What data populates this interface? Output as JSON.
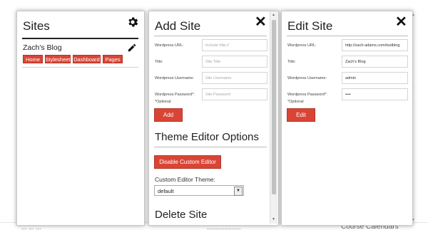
{
  "background": {
    "left_text": "... ... ...",
    "mid_text": "...................",
    "right_text": "Course Calendars"
  },
  "sites_panel": {
    "title": "Sites",
    "site_name": "Zach's Blog",
    "buttons": [
      "Home",
      "Stylesheet",
      "Dashboard",
      "Pages"
    ]
  },
  "add_site_panel": {
    "title": "Add Site",
    "fields": [
      {
        "label": "Wordpress URL:",
        "placeholder": "Include http://",
        "value": ""
      },
      {
        "label": "Title:",
        "placeholder": "Site Title",
        "value": ""
      },
      {
        "label": "Wordpress Username:",
        "placeholder": "Site Username",
        "value": ""
      },
      {
        "label": "Wordpress Password*:",
        "placeholder": "Site Password",
        "value": ""
      }
    ],
    "optional_note": "*Optional",
    "add_button": "Add",
    "theme_section_title": "Theme Editor Options",
    "disable_button": "Disable Custom Editor",
    "custom_theme_label": "Custom Editor Theme:",
    "theme_value": "default",
    "delete_section_title": "Delete Site"
  },
  "edit_site_panel": {
    "title": "Edit Site",
    "fields": [
      {
        "label": "Wordpress URL:",
        "value": "http://zach-adams.com/testblog"
      },
      {
        "label": "Title:",
        "value": "Zach's Blog"
      },
      {
        "label": "Wordpress Username:",
        "value": "admin"
      },
      {
        "label": "Wordpress Password*:",
        "value": "••••"
      }
    ],
    "optional_note": "*Optional",
    "edit_button": "Edit"
  },
  "colors": {
    "accent": "#d94535"
  }
}
